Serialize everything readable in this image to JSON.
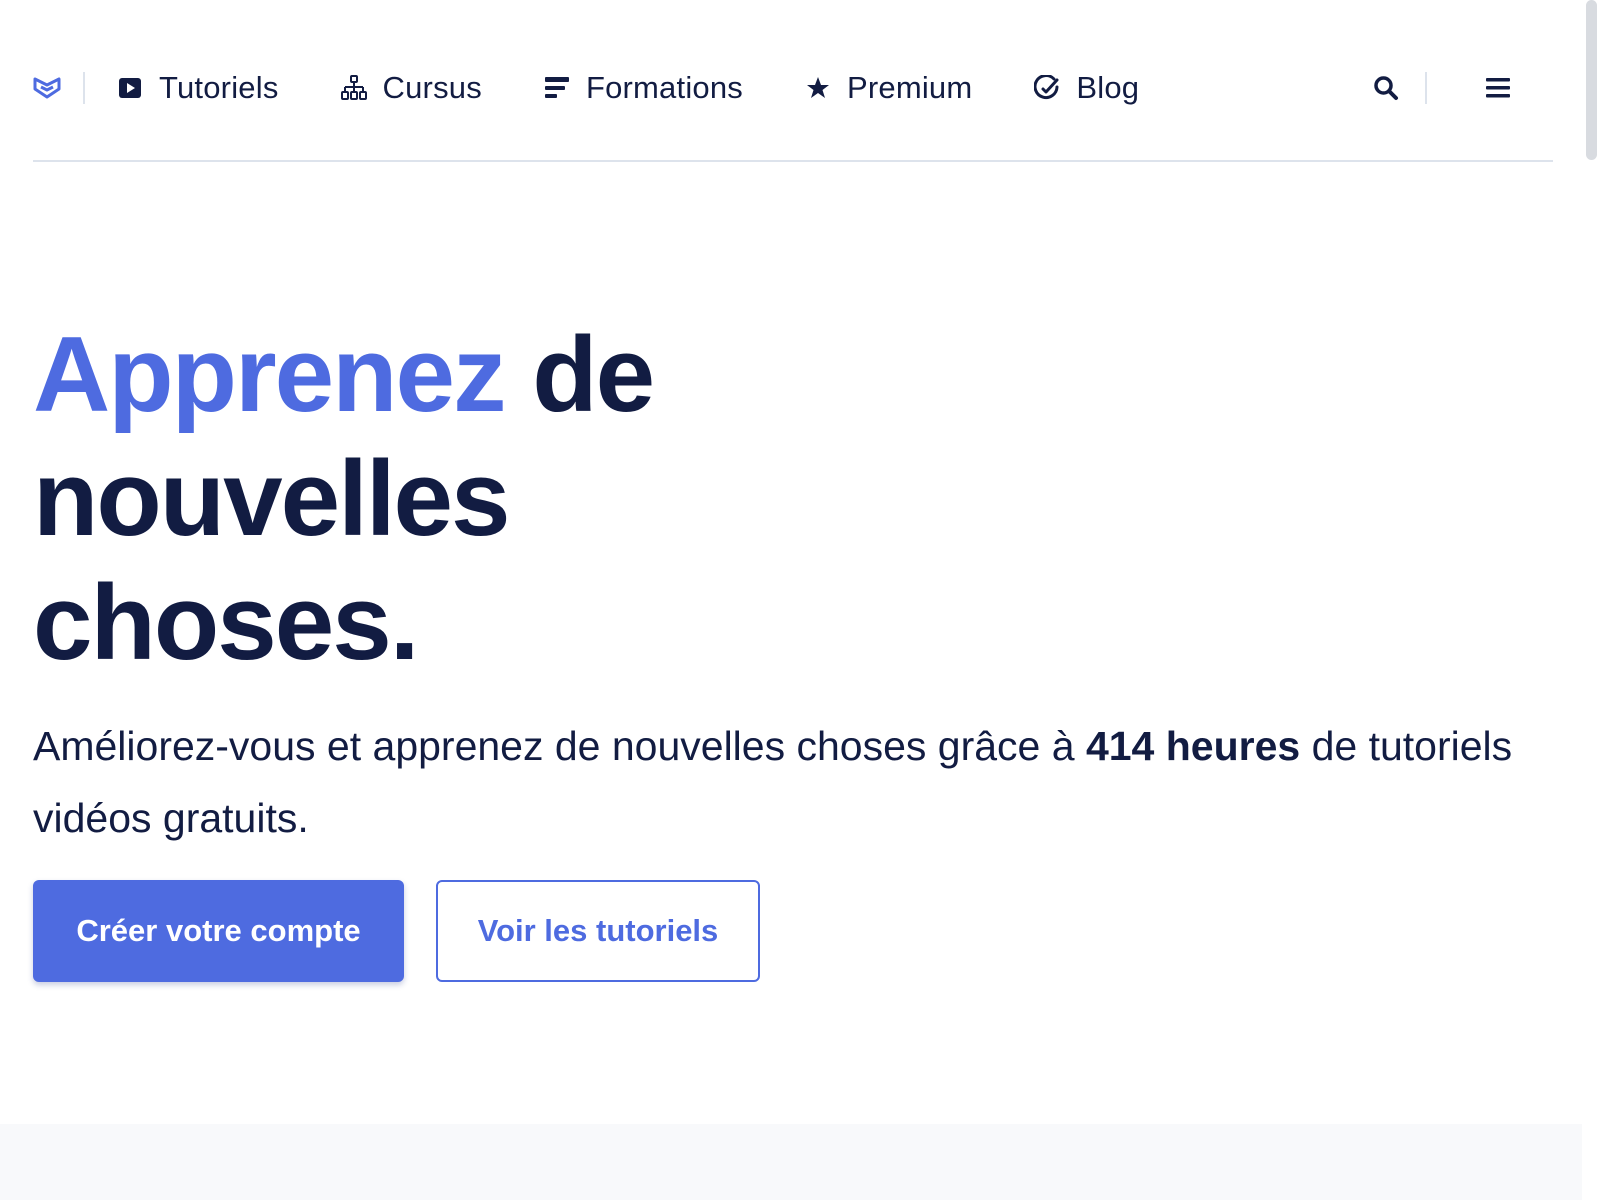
{
  "header": {
    "logo_icon": "grafikart-logo-icon",
    "nav": [
      {
        "label": "Tutoriels",
        "icon": "play-icon"
      },
      {
        "label": "Cursus",
        "icon": "sitemap-icon"
      },
      {
        "label": "Formations",
        "icon": "lines-icon"
      },
      {
        "label": "Premium",
        "icon": "star-icon"
      },
      {
        "label": "Blog",
        "icon": "pen-icon"
      }
    ],
    "search_icon": "search-icon",
    "menu_icon": "hamburger-menu-icon"
  },
  "hero": {
    "title_accent": "Apprenez",
    "title_rest": " de nouvelles choses.",
    "desc_before": "Améliorez-vous et apprenez de nouvelles choses grâce à ",
    "desc_strong": "414 heures",
    "desc_after": " de tutoriels vidéos gratuits.",
    "primary_button": "Créer votre compte",
    "secondary_button": "Voir les tutoriels"
  },
  "colors": {
    "accent": "#4e6be0",
    "text": "#121c42",
    "rule": "#dde3ec",
    "band": "#f8f9fb"
  }
}
